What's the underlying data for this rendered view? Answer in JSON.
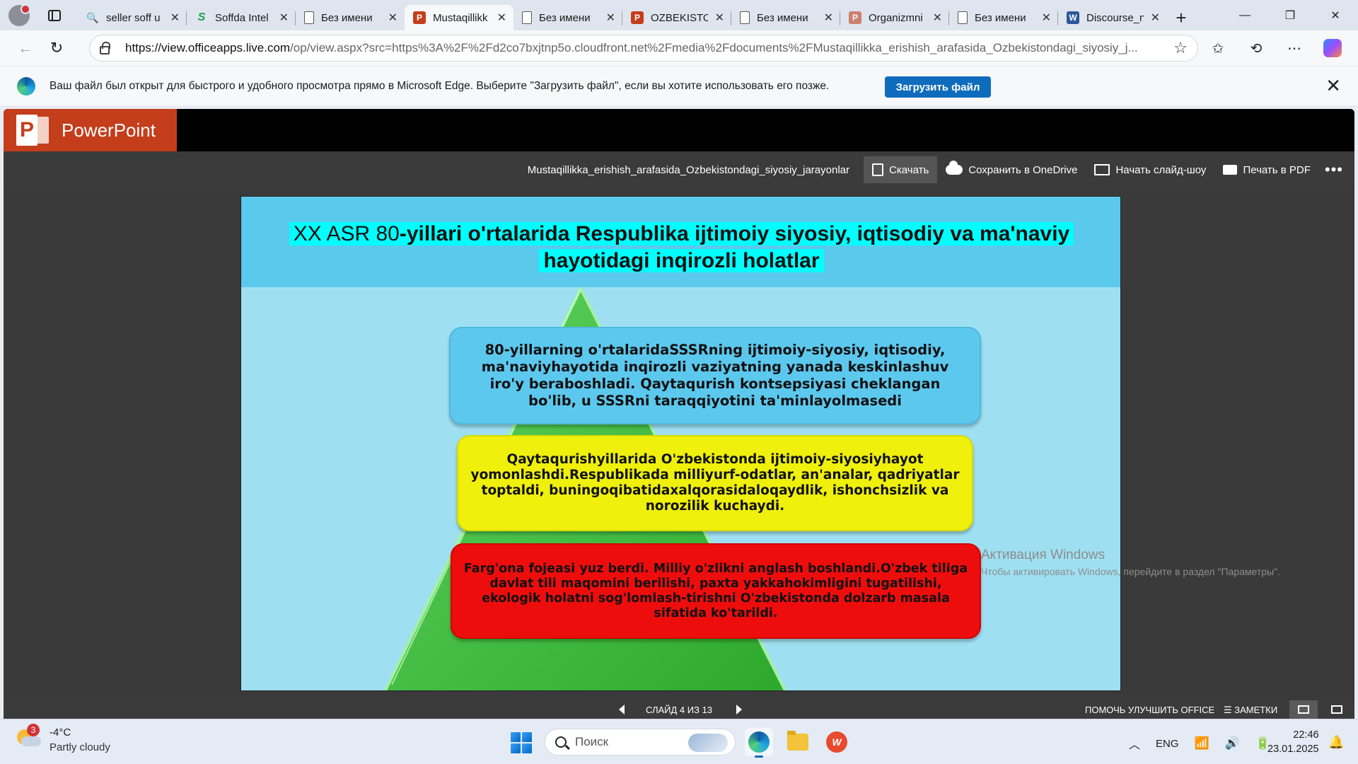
{
  "browser": {
    "tabs": [
      {
        "title": "seller soff u",
        "favicon": "search-icon",
        "active": false
      },
      {
        "title": "Soffda Intel",
        "favicon": "soffda-icon",
        "active": false
      },
      {
        "title": "Без имени",
        "favicon": "document-icon",
        "active": false
      },
      {
        "title": "Mustaqillikk",
        "favicon": "powerpoint-icon",
        "active": true
      },
      {
        "title": "Без имени",
        "favicon": "document-icon",
        "active": false
      },
      {
        "title": "OZBEKISTO",
        "favicon": "powerpoint-icon",
        "active": false
      },
      {
        "title": "Без имени",
        "favicon": "document-icon",
        "active": false
      },
      {
        "title": "Organizmni",
        "favicon": "powerpoint-icon",
        "active": false
      },
      {
        "title": "Без имени",
        "favicon": "document-icon",
        "active": false
      },
      {
        "title": "Discourse_n",
        "favicon": "word-icon",
        "active": false
      }
    ],
    "url_host": "https://view.officeapps.live.com",
    "url_path": "/op/view.aspx?src=https%3A%2F%2Fd2co7bxjtnp5o.cloudfront.net%2Fmedia%2Fdocuments%2FMustaqillikka_erishish_arafasida_Ozbekistondagi_siyosiy_j..."
  },
  "infobar": {
    "message": "Ваш файл был открыт для быстрого и удобного просмотра прямо в Microsoft Edge. Выберите \"Загрузить файл\", если вы хотите использовать его позже.",
    "download_label": "Загрузить файл"
  },
  "app": {
    "brand": "PowerPoint",
    "filename": "Mustaqillikka_erishish_arafasida_Ozbekistondagi_siyosiy_jarayonlar",
    "commands": {
      "download": "Скачать",
      "save_onedrive": "Сохранить в OneDrive",
      "slideshow": "Начать слайд-шоу",
      "print_pdf": "Печать в PDF"
    },
    "accent": "#c43e1c"
  },
  "slide": {
    "title_light": "XX ASR 80",
    "title_bold": "-yillari o'rtalarida Respublika ijtimoiy siyosiy, iqtisodiy va ma'naviy hayotidagi inqirozli holatlar",
    "box1": "80-yillarning o'rtalaridaSSSRning ijtimoiy-siyosiy, iqtisodiy, ma'naviyhayotida inqirozli vaziyatning yanada keskinlashuv iro'y beraboshladi. Qaytaqurish kontsepsiyasi cheklangan bo'lib, u SSSRni taraqqiyotini ta'minlayolmasedi",
    "box2": "Qaytaqurishyillarida O'zbekistonda ijtimoiy-siyosiyhayot yomonlashdi.Respublikada milliyurf-odatlar, an'analar, qadriyatlar toptaldi, buningoqibatidaxalqorasidaloqaydlik, ishonchsizlik va norozilik kuchaydi.",
    "box3": "Farg'ona fojeasi yuz berdi. Milliy o'zlikni anglash boshlandi.O'zbek tiliga davlat tili maqomini berilishi, paxta yakkahokimligini tugatilishi, ekologik holatni sog'lomlash-tirishni O'zbekistonda dolzarb masala sifatida ko'tarildi."
  },
  "watermark": {
    "line1": "Активация Windows",
    "line2": "Чтобы активировать Windows, перейдите в раздел \"Параметры\"."
  },
  "status": {
    "slide_counter": "СЛАЙД 4 ИЗ 13",
    "help": "ПОМОЧЬ УЛУЧШИТЬ OFFICE",
    "notes": "ЗАМЕТКИ"
  },
  "taskbar": {
    "weather_badge": "3",
    "temp": "-4°C",
    "condition": "Partly cloudy",
    "search_placeholder": "Поиск",
    "lang": "ENG",
    "time": "22:46",
    "date": "23.01.2025"
  }
}
